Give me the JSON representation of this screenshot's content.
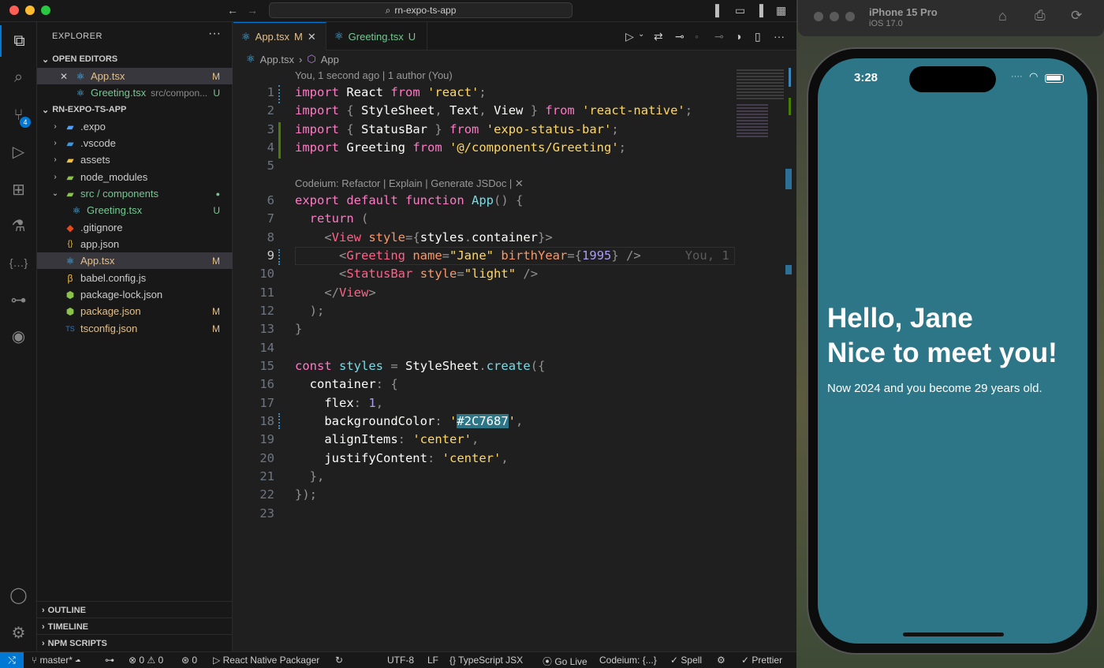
{
  "vscode": {
    "command_center": "rn-expo-ts-app",
    "explorer_title": "EXPLORER",
    "open_editors": {
      "heading": "OPEN EDITORS",
      "items": [
        {
          "name": "App.tsx",
          "status": "M",
          "desc": ""
        },
        {
          "name": "Greeting.tsx",
          "status": "U",
          "desc": "src/compon..."
        }
      ]
    },
    "project": {
      "heading": "RN-EXPO-TS-APP",
      "items": [
        {
          "name": ".expo",
          "status": ""
        },
        {
          "name": ".vscode",
          "status": ""
        },
        {
          "name": "assets",
          "status": ""
        },
        {
          "name": "node_modules",
          "status": ""
        },
        {
          "name": "src / components",
          "status": "●"
        },
        {
          "name": "Greeting.tsx",
          "status": "U"
        },
        {
          "name": ".gitignore",
          "status": ""
        },
        {
          "name": "app.json",
          "status": ""
        },
        {
          "name": "App.tsx",
          "status": "M"
        },
        {
          "name": "babel.config.js",
          "status": ""
        },
        {
          "name": "package-lock.json",
          "status": ""
        },
        {
          "name": "package.json",
          "status": "M"
        },
        {
          "name": "tsconfig.json",
          "status": "M"
        }
      ]
    },
    "bottom_sections": [
      "OUTLINE",
      "TIMELINE",
      "NPM SCRIPTS"
    ],
    "source_control_badge": "4",
    "tabs": [
      {
        "name": "App.tsx",
        "status": "M"
      },
      {
        "name": "Greeting.tsx",
        "status": "U"
      }
    ],
    "breadcrumb": [
      "App.tsx",
      "App"
    ],
    "blame_lens": "You, 1 second ago | 1 author (You)",
    "codeium_lens": "Codeium: Refactor | Explain | Generate JSDoc | ✕",
    "inline_blame": "You, 1",
    "line_numbers": [
      "1",
      "2",
      "3",
      "4",
      "5",
      "6",
      "7",
      "8",
      "9",
      "10",
      "11",
      "12",
      "13",
      "14",
      "15",
      "16",
      "17",
      "18",
      "19",
      "20",
      "21",
      "22",
      "23"
    ],
    "status_bar": {
      "branch": "master*",
      "errors": "0",
      "warnings": "0",
      "ports": "0",
      "packager": "React Native Packager",
      "encoding": "UTF-8",
      "eol": "LF",
      "language": "TypeScript JSX",
      "golive": "Go Live",
      "codeium": "Codeium: {...}",
      "spell": "Spell",
      "prettier": "Prettier"
    }
  },
  "simulator": {
    "device": "iPhone 15 Pro",
    "os": "iOS 17.0",
    "time": "3:28",
    "screen_color": "#2C7687",
    "heading_line1": "Hello, Jane",
    "heading_line2": "Nice to meet you!",
    "body": "Now 2024 and you become 29 years old."
  },
  "colors": {
    "accent": "#0078d4",
    "modified": "#e2c08d",
    "untracked": "#73c991"
  }
}
